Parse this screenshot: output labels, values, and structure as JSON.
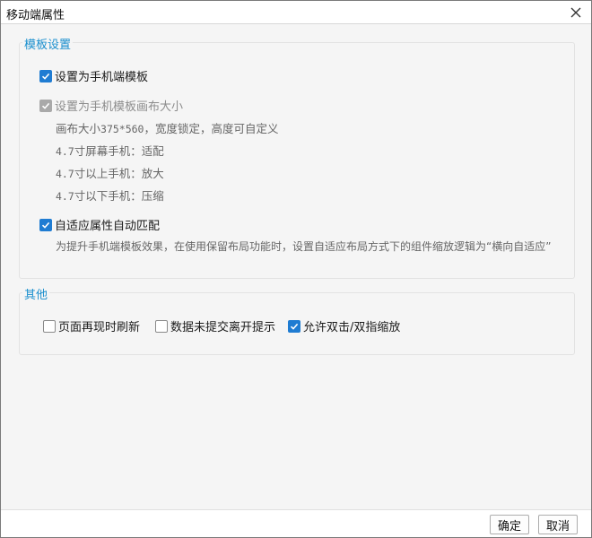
{
  "window": {
    "title": "移动端属性"
  },
  "template_group": {
    "title": "模板设置",
    "use_mobile_template": {
      "label": "设置为手机端模板",
      "checked": true
    },
    "canvas_size": {
      "label": "设置为手机模板画布大小",
      "checked": true,
      "disabled": true
    },
    "canvas_note": {
      "prefix": "画布大小",
      "size": "375*560",
      "suffix": "，宽度锁定，高度可自定义"
    },
    "screen_notes": [
      {
        "size": "4.7",
        "text": "寸屏幕手机：适配"
      },
      {
        "size": "4.7",
        "text": "寸以上手机：放大"
      },
      {
        "size": "4.7",
        "text": "寸以下手机：压缩"
      }
    ],
    "auto_match": {
      "label": "自适应属性自动匹配",
      "checked": true
    },
    "auto_match_note": "为提升手机端模板效果，在使用保留布局功能时，设置自适应布局方式下的组件缩放逻辑为“横向自适应”"
  },
  "other_group": {
    "title": "其他",
    "refresh_on_reappear": {
      "label": "页面再现时刷新",
      "checked": false
    },
    "leave_prompt": {
      "label": "数据未提交离开提示",
      "checked": false
    },
    "allow_zoom": {
      "label": "允许双击/双指缩放",
      "checked": true
    }
  },
  "footer": {
    "ok_label": "确定",
    "cancel_label": "取消"
  },
  "colors": {
    "accent": "#1f7cd2",
    "group_title": "#1a8fce",
    "disabled_checkbox": "#a9a9a9"
  }
}
